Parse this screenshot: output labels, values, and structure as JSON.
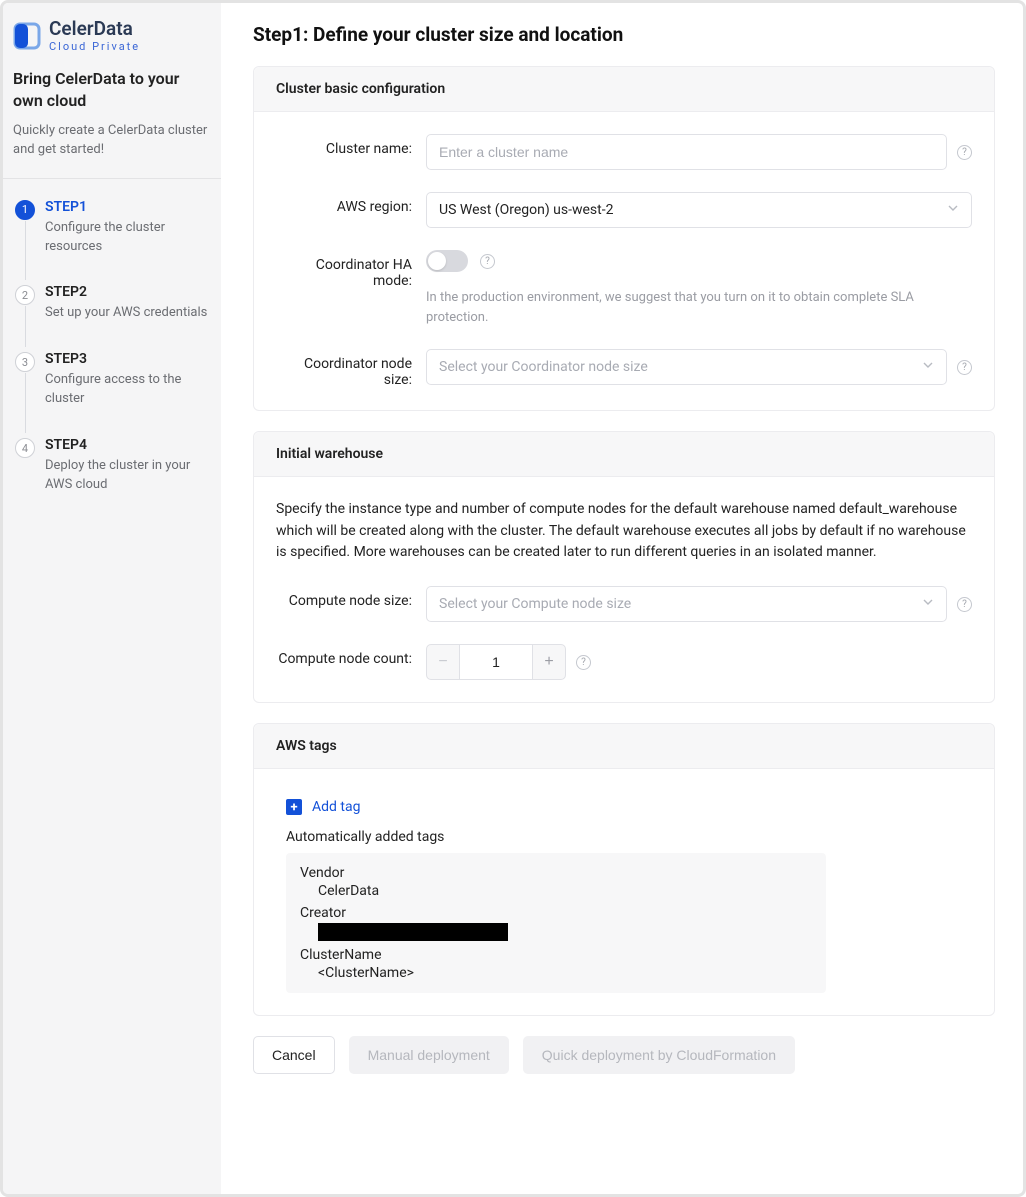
{
  "brand": {
    "name": "CelerData",
    "subtitle": "Cloud  Private"
  },
  "sidebar": {
    "intro_title": "Bring CelerData to your own cloud",
    "intro_sub": "Quickly create a CelerData cluster and get started!",
    "steps": [
      {
        "name": "STEP1",
        "desc": "Configure the cluster resources"
      },
      {
        "name": "STEP2",
        "desc": "Set up your AWS credentials"
      },
      {
        "name": "STEP3",
        "desc": "Configure access to the cluster"
      },
      {
        "name": "STEP4",
        "desc": "Deploy the cluster in your AWS cloud"
      }
    ]
  },
  "page_title": "Step1: Define your cluster size and location",
  "panels": {
    "basic": {
      "title": "Cluster basic configuration",
      "cluster_name_label": "Cluster name:",
      "cluster_name_placeholder": "Enter a cluster name",
      "region_label": "AWS region:",
      "region_value": "US West (Oregon) us-west-2",
      "ha_label": "Coordinator HA mode:",
      "ha_hint": "In the production environment, we suggest that you turn on it to obtain complete SLA protection.",
      "coord_size_label": "Coordinator node size:",
      "coord_size_placeholder": "Select your Coordinator node size"
    },
    "warehouse": {
      "title": "Initial warehouse",
      "desc": "Specify the instance type and number of compute nodes for the default warehouse named default_warehouse which will be created along with the cluster. The default warehouse executes all jobs by default if no warehouse is specified. More warehouses can be created later to run different queries in an isolated manner.",
      "compute_size_label": "Compute node size:",
      "compute_size_placeholder": "Select your Compute node size",
      "compute_count_label": "Compute node count:",
      "compute_count_value": "1"
    },
    "tags": {
      "title": "AWS tags",
      "add_label": "Add tag",
      "auto_title": "Automatically added tags",
      "items": [
        {
          "key": "Vendor",
          "val": "CelerData"
        },
        {
          "key": "Creator",
          "val": "[REDACTED]"
        },
        {
          "key": "ClusterName",
          "val": "<ClusterName>"
        }
      ]
    }
  },
  "footer": {
    "cancel": "Cancel",
    "manual": "Manual deployment",
    "quick": "Quick deployment by CloudFormation"
  }
}
